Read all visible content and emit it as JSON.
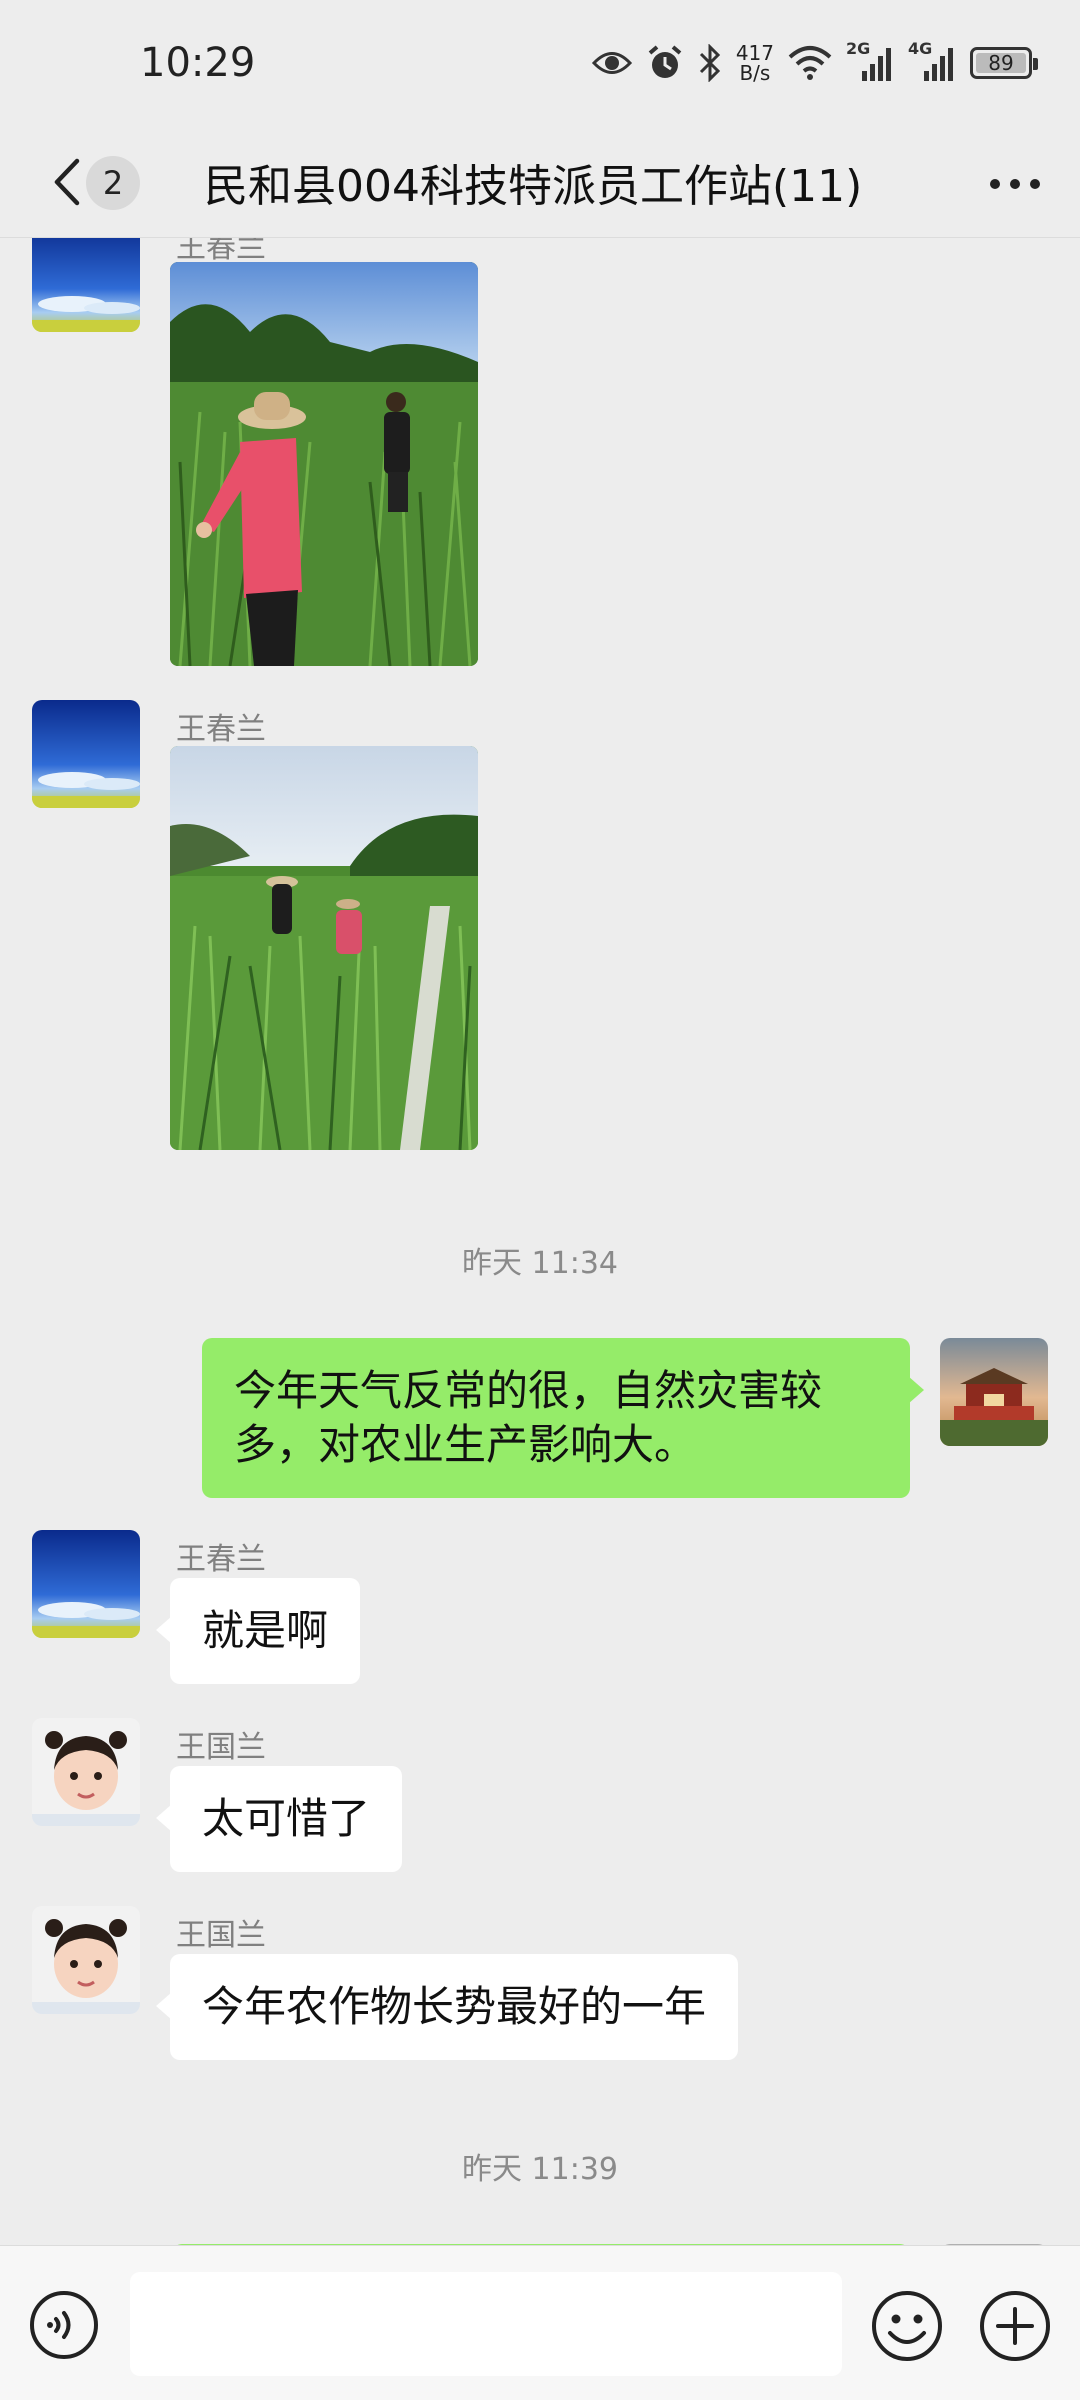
{
  "status_bar": {
    "time": "10:29",
    "net_speed": [
      "417",
      "B/s"
    ],
    "sim1": "2G",
    "sim2": "4G",
    "battery": "89",
    "battery_level_percent": 89
  },
  "header": {
    "unread_count": "2",
    "title": "民和县004科技特派员工作站(11)"
  },
  "messages": [
    {
      "type": "image",
      "sender": "王春兰",
      "side": "left"
    },
    {
      "type": "image",
      "sender": "王春兰",
      "side": "left"
    },
    {
      "type": "timestamp",
      "text": "昨天 11:34"
    },
    {
      "type": "text",
      "side": "right",
      "lines": [
        "今年天气反常的很，自然灾害较",
        "多，对农业生产影响大。"
      ]
    },
    {
      "type": "text",
      "sender": "王春兰",
      "side": "left",
      "text": "就是啊"
    },
    {
      "type": "text",
      "sender": "王国兰",
      "side": "left",
      "text": "太可惜了"
    },
    {
      "type": "text",
      "sender": "王国兰",
      "side": "left",
      "text": "今年农作物长势最好的一年"
    },
    {
      "type": "timestamp",
      "text": "昨天 11:39"
    }
  ],
  "input_bar": {
    "value": "",
    "placeholder": ""
  },
  "colors": {
    "background": "#ededed",
    "my_bubble": "#95ec69",
    "other_bubble": "#ffffff",
    "meta_text": "#808080"
  },
  "icons": [
    "eye-icon",
    "alarm-icon",
    "bluetooth-icon",
    "wifi-icon",
    "signal-icon",
    "battery-icon",
    "back-chevron-icon",
    "more-dots-icon",
    "voice-icon",
    "emoji-icon",
    "plus-icon"
  ]
}
